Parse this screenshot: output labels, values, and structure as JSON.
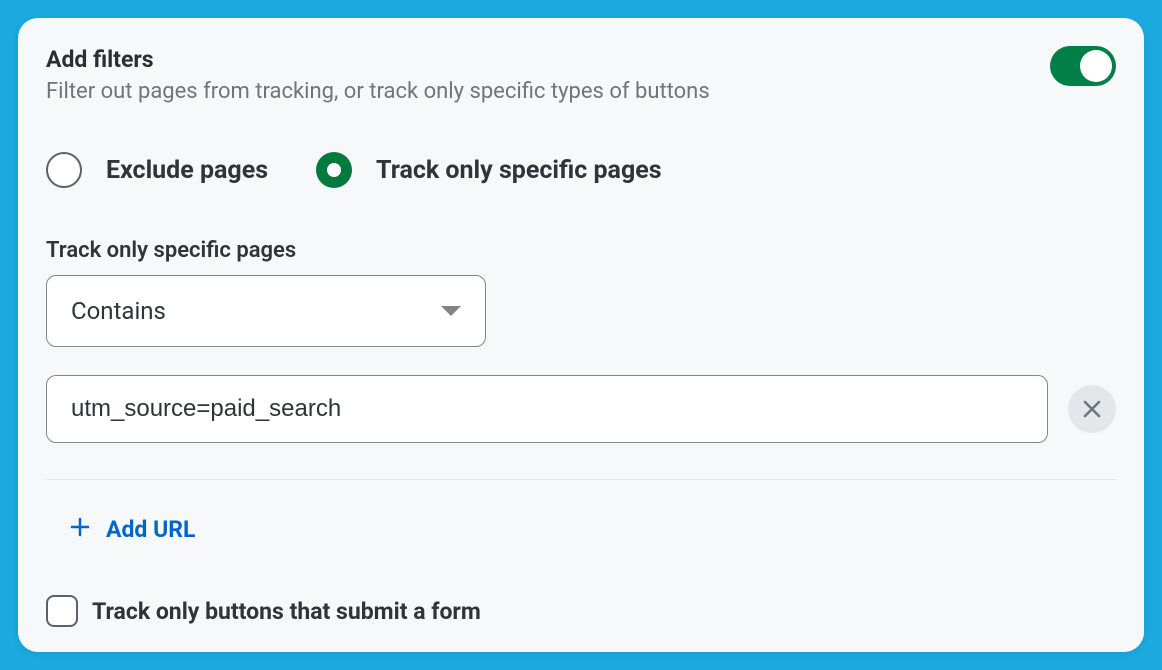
{
  "header": {
    "title": "Add filters",
    "subtitle": "Filter out pages from tracking, or track only specific types of buttons"
  },
  "toggle": {
    "on": true
  },
  "radios": {
    "exclude_label": "Exclude pages",
    "track_specific_label": "Track only specific pages",
    "selected": "track_specific"
  },
  "section_label": "Track only specific pages",
  "match_type": {
    "selected": "Contains"
  },
  "url_input": {
    "value": "utm_source=paid_search"
  },
  "add_url_label": "Add URL",
  "checkbox": {
    "label": "Track only buttons that submit a form",
    "checked": false
  }
}
